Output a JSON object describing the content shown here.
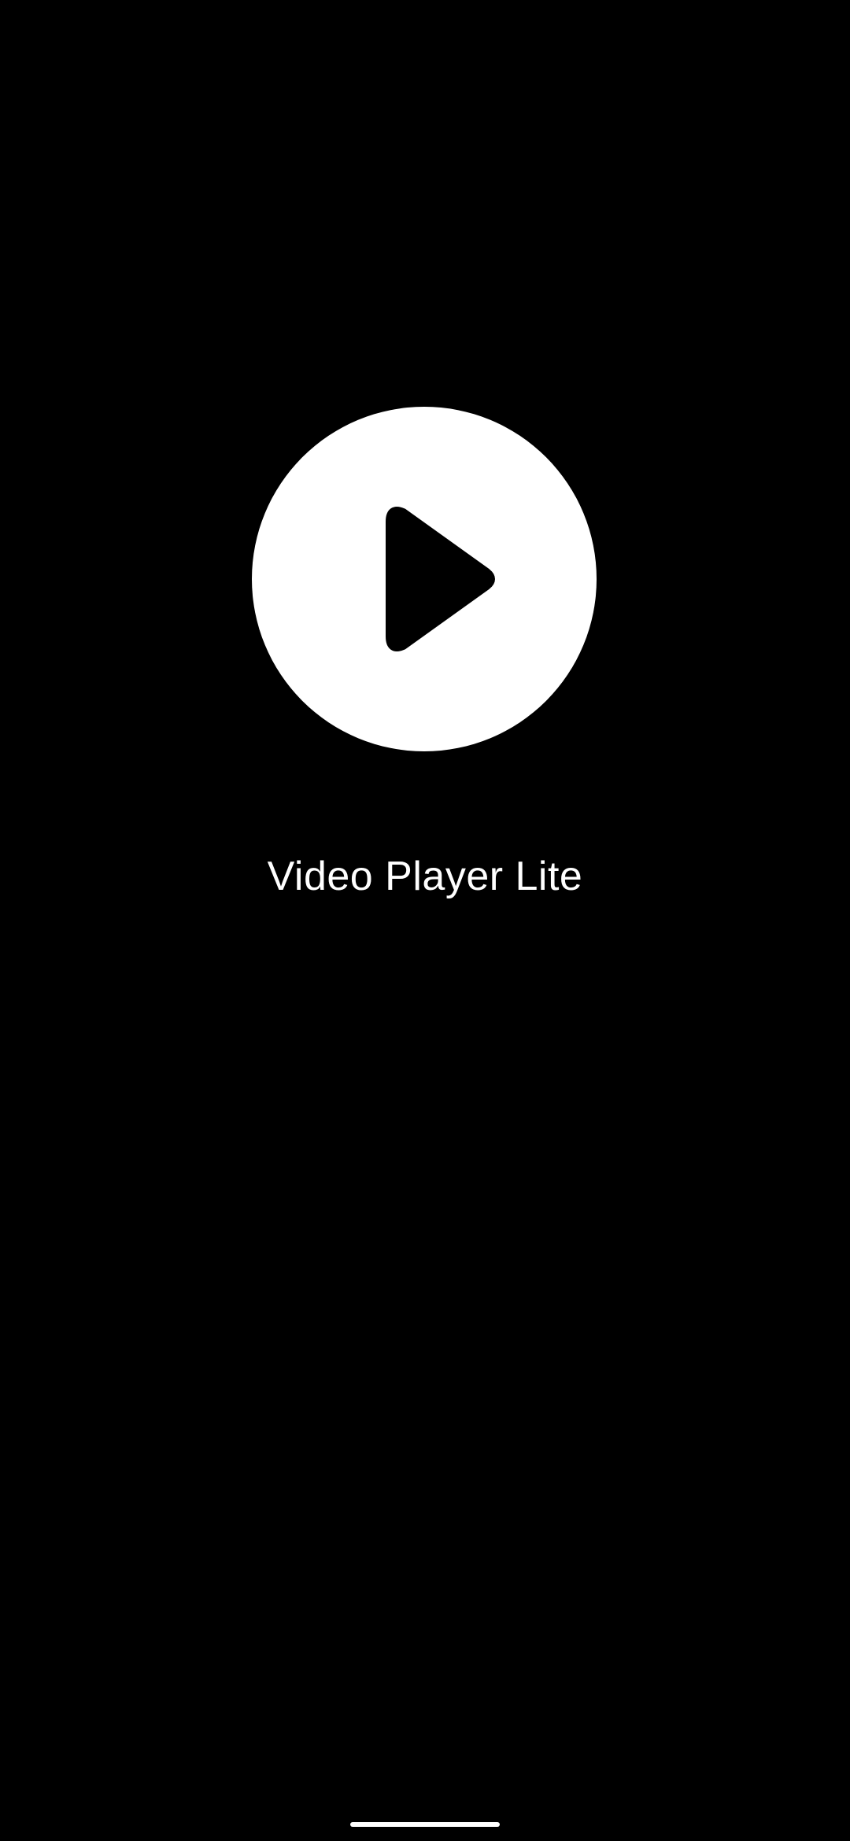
{
  "splash": {
    "logo_icon": "play-icon",
    "app_name": "Video Player Lite"
  },
  "colors": {
    "background": "#000000",
    "logo_circle": "#ffffff",
    "logo_glyph": "#000000",
    "text": "#ffffff"
  },
  "navigation": {
    "gesture_bar": "home-gesture-handle"
  }
}
